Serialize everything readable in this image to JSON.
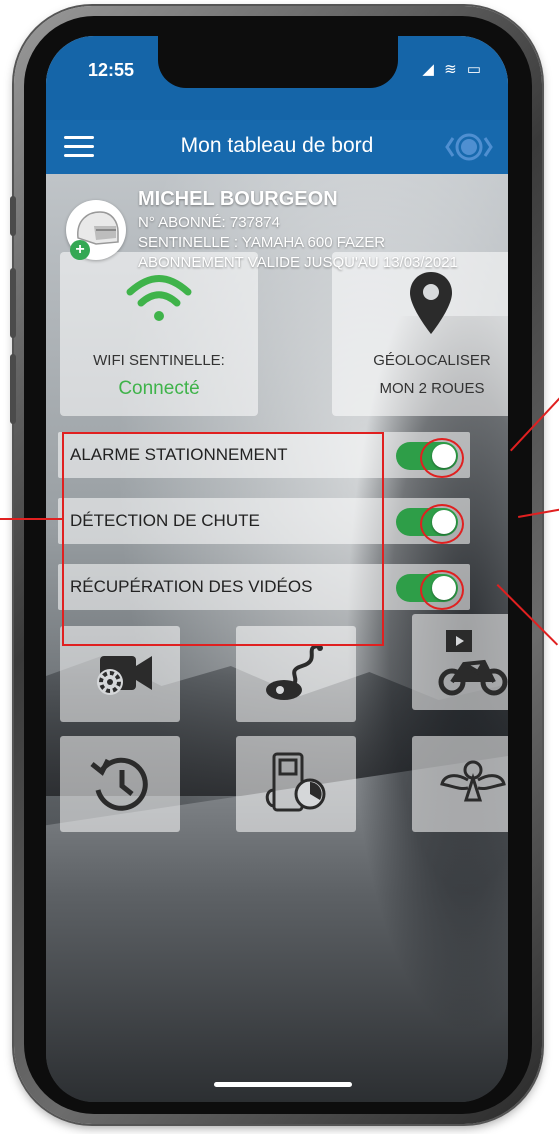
{
  "status": {
    "time": "12:55",
    "icons": "◢ ≋ ▭"
  },
  "appbar": {
    "title": "Mon tableau de bord"
  },
  "profile": {
    "name": "MICHEL BOURGEON",
    "subscriber": "N° ABONNÉ: 737874",
    "sentinel": "SENTINELLE : YAMAHA 600 FAZER",
    "validity": "ABONNEMENT VALIDE JUSQU'AU 13/03/2021"
  },
  "cards": {
    "wifi": {
      "label": "WIFI SENTINELLE:",
      "status": "Connecté",
      "status_color": "#3fb34a"
    },
    "geo": {
      "label_1": "GÉOLOCALISER",
      "label_2": "MON 2 ROUES"
    }
  },
  "toggles": [
    {
      "label": "ALARME STATIONNEMENT",
      "on": true
    },
    {
      "label": "DÉTECTION DE CHUTE",
      "on": true
    },
    {
      "label": "RÉCUPÉRATION DES VIDÉOS",
      "on": true
    }
  ],
  "tiles": [
    {
      "icon": "camera-settings-icon"
    },
    {
      "icon": "route-icon"
    },
    {
      "icon": "bike-video-icon"
    },
    {
      "icon": "history-icon"
    },
    {
      "icon": "fuel-timer-icon"
    },
    {
      "icon": "angel-icon"
    }
  ],
  "colors": {
    "appbar": "#1769ad",
    "toggle_on": "#2e9e48",
    "annotation": "#e02020",
    "wifi_green": "#3fb34a"
  }
}
